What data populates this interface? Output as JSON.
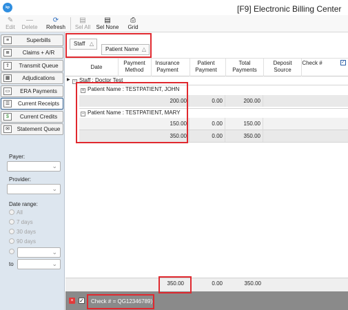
{
  "window": {
    "title": "[F9] Electronic Billing Center",
    "logo": "kp"
  },
  "toolbar": {
    "edit": "Edit",
    "delete": "Delete",
    "refresh": "Refresh",
    "sel_all": "Sel All",
    "sel_none": "Sel None",
    "grid": "Grid"
  },
  "sidebar": {
    "items": [
      {
        "label": "Superbills",
        "icon": "superbills-icon"
      },
      {
        "label": "Claims + A/R",
        "icon": "claims-icon"
      },
      {
        "label": "Transmit Queue",
        "icon": "transmit-icon"
      },
      {
        "label": "Adjudications",
        "icon": "adjudications-icon"
      },
      {
        "label": "ERA Payments",
        "icon": "era-icon"
      },
      {
        "label": "Current Receipts",
        "icon": "receipts-icon"
      },
      {
        "label": "Current Credits",
        "icon": "credits-icon"
      },
      {
        "label": "Statement Queue",
        "icon": "statement-icon"
      }
    ],
    "payer_label": "Payer:",
    "provider_label": "Provider:",
    "date_range_label": "Date range:",
    "radios": [
      "All",
      "7 days",
      "30 days",
      "90 days"
    ],
    "to_label": "to"
  },
  "grouping": {
    "chip1": "Staff",
    "chip2": "Patient Name"
  },
  "columns": {
    "date": "Date",
    "payment_method": "Payment Method",
    "insurance_payment": "Insurance Payment",
    "patient_payment": "Patient Payment",
    "total_payments": "Total Payments",
    "deposit_source": "Deposit Source",
    "check_no": "Check #"
  },
  "grid": {
    "staff_group": "Staff : Doctor Test",
    "patients": [
      {
        "label": "Patient Name : TESTPATIENT, JOHN",
        "rows": [
          {
            "insurance": "200.00",
            "patient": "0.00",
            "total": "200.00"
          }
        ]
      },
      {
        "label": "Patient Name : TESTPATIENT, MARY",
        "rows": [
          {
            "insurance": "150.00",
            "patient": "0.00",
            "total": "150.00"
          },
          {
            "insurance": "350.00",
            "patient": "0.00",
            "total": "350.00"
          }
        ]
      }
    ]
  },
  "summary": {
    "insurance": "350.00",
    "patient": "0.00",
    "total": "350.00"
  },
  "filter": {
    "close": "×",
    "checkbox": "✓",
    "text": "Check # = QG12346789)"
  },
  "colors": {
    "highlight": "#e0282e",
    "sidebar": "#dde6ef",
    "accent": "#2f8ee0"
  }
}
